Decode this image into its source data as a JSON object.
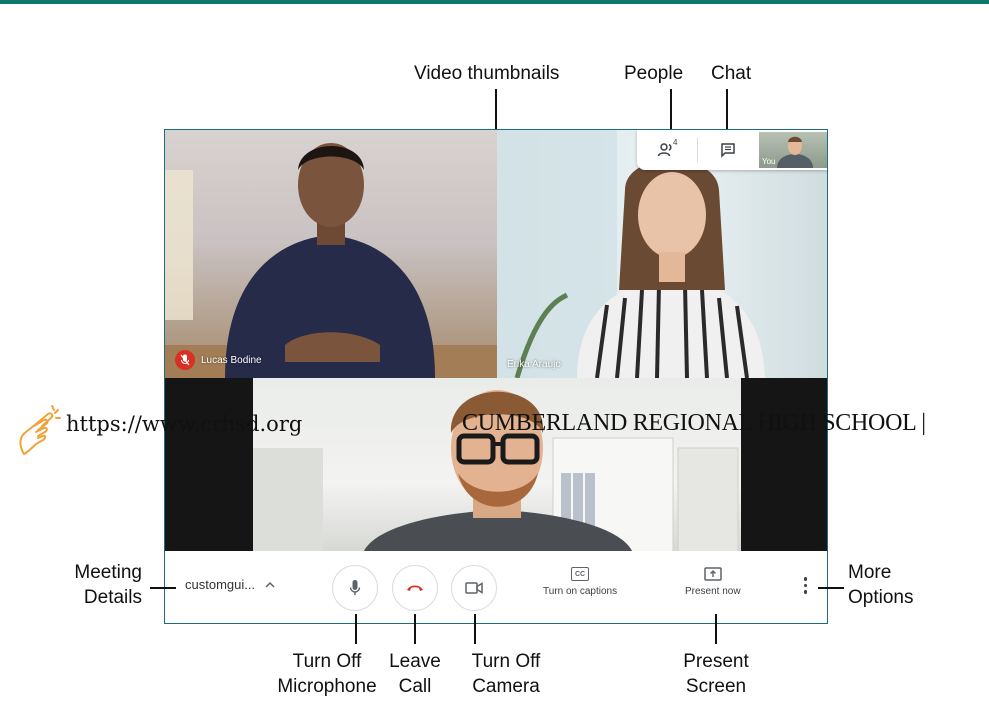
{
  "annotations": {
    "video_thumbnails": "Video thumbnails",
    "people": "People",
    "chat": "Chat",
    "meeting_details": "Meeting\nDetails",
    "more_options": "More\nOptions",
    "turn_off_microphone": "Turn Off\nMicrophone",
    "leave_call": "Leave\nCall",
    "turn_off_camera": "Turn Off\nCamera",
    "present_screen": "Present\nScreen"
  },
  "tiles": {
    "participant_1": "Lucas Bodine",
    "participant_2": "Erika Araujo"
  },
  "top_panel": {
    "people_count": "4",
    "self_label": "You"
  },
  "controls": {
    "meeting_code": "customgui...",
    "captions_label": "Turn on captions",
    "present_label": "Present now",
    "captions_icon": "CC"
  },
  "watermark": {
    "url": "https://www.crhsd.org",
    "school": "CUMBERLAND REGIONAL HIGH SCHOOL |"
  },
  "colors": {
    "accent": "#0b7a6b",
    "leave": "#d93025",
    "muted": "#d93025"
  },
  "icons": [
    "people-icon",
    "chat-icon",
    "microphone-icon",
    "end-call-icon",
    "camera-icon",
    "captions-icon",
    "present-icon",
    "more-vert-icon",
    "chevron-up-icon",
    "mic-off-icon",
    "hand-pointer-icon"
  ]
}
